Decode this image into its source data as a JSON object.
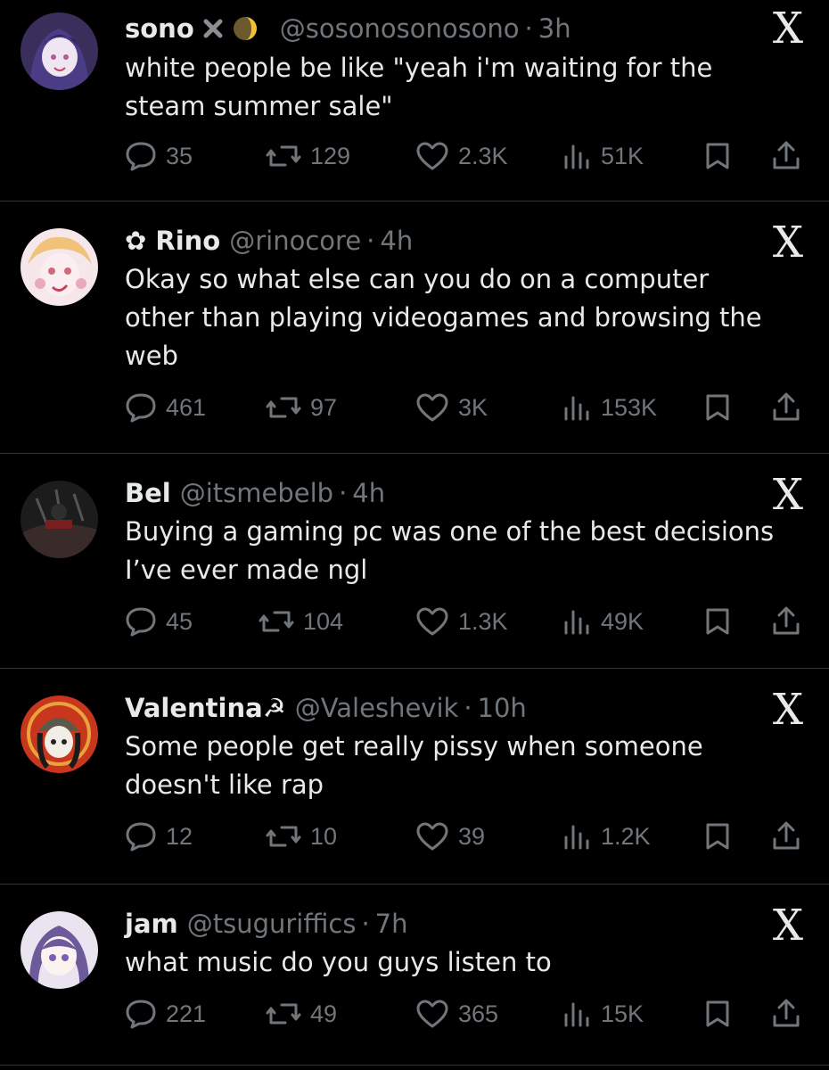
{
  "tweets": [
    {
      "name": "sono",
      "handle": "@sosonosonosono",
      "time": "3h",
      "text": "white people be like \"yeah i'm waiting for the\nsteam summer sale\"",
      "replies": "35",
      "reposts": "129",
      "likes": "2.3K",
      "views": "51K",
      "badges": [
        "x-mark-icon",
        "moon-emoji-icon"
      ]
    },
    {
      "name": "✿ Rino",
      "handle": "@rinocore",
      "time": "4h",
      "text": "Okay so what else can you do on a computer\nother than playing videogames and browsing the\nweb",
      "replies": "461",
      "reposts": "97",
      "likes": "3K",
      "views": "153K"
    },
    {
      "name": "Bel",
      "handle": "@itsmebelb",
      "time": "4h",
      "text": "Buying a gaming pc was one of the best decisions\nI’ve ever made ngl",
      "replies": "45",
      "reposts": "104",
      "likes": "1.3K",
      "views": "49K"
    },
    {
      "name": "Valentina☭",
      "handle": "@Valeshevik",
      "time": "10h",
      "text": "Some people get really pissy when someone\ndoesn't like rap",
      "replies": "12",
      "reposts": "10",
      "likes": "39",
      "views": "1.2K"
    },
    {
      "name": "jam",
      "handle": "@tsuguriffics",
      "time": "7h",
      "text": "what music do you guys listen to",
      "replies": "221",
      "reposts": "49",
      "likes": "365",
      "views": "15K"
    }
  ],
  "separator": "·",
  "source_logo": "X",
  "colors": {
    "background": "#000000",
    "text": "#e7e9ea",
    "muted": "#71767b",
    "divider": "#2f3336"
  }
}
